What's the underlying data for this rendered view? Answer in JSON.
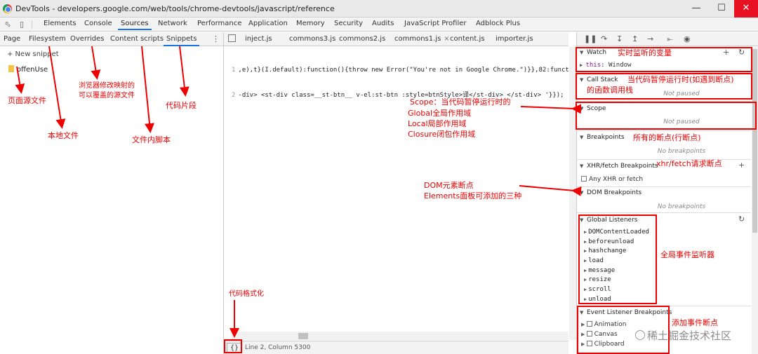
{
  "window": {
    "title": "DevTools - developers.google.com/web/tools/chrome-devtools/javascript/reference"
  },
  "main_tabs": [
    "Elements",
    "Console",
    "Sources",
    "Network",
    "Performance",
    "Application",
    "Memory",
    "Security",
    "Audits",
    "JavaScript Profiler",
    "Adblock Plus"
  ],
  "active_main_tab": "Sources",
  "navigator": {
    "tabs": [
      "Page",
      "Filesystem",
      "Overrides",
      "Content scripts",
      "Snippets"
    ],
    "active_tab": "Snippets",
    "new_snippet": "+ New snippet",
    "file": "offenUse"
  },
  "editor": {
    "tabs": [
      "inject.js",
      "commons3.js",
      "commons2.js",
      "commons1.js",
      "content.js",
      "importer.js"
    ],
    "active_tab": "commons1.js",
    "lines": [
      {
        "num": "1",
        "text": ",e),t}(I.default):function(){throw new Error(\"You're not in Google Chrome.\")}},82:funct"
      },
      {
        "num": "2",
        "text": "-div> <st-div class=__st-btn__ v-el:st-btn :style=btnStyle>译</st-div> </st-div> '}});"
      }
    ],
    "format_button": "{}",
    "status": "Line 2, Column 5300"
  },
  "debugger": {
    "watch": {
      "title": "Watch",
      "value_key": "this",
      "value": "Window"
    },
    "call_stack": {
      "title": "Call Stack",
      "empty": "Not paused"
    },
    "scope": {
      "title": "Scope",
      "empty": "Not paused"
    },
    "breakpoints": {
      "title": "Breakpoints",
      "empty": "No breakpoints"
    },
    "xhr": {
      "title": "XHR/fetch Breakpoints",
      "item": "Any XHR or fetch"
    },
    "dom": {
      "title": "DOM Breakpoints",
      "empty": "No breakpoints"
    },
    "global_listeners": {
      "title": "Global Listeners",
      "items": [
        "DOMContentLoaded",
        "beforeunload",
        "hashchange",
        "load",
        "message",
        "resize",
        "scroll",
        "unload"
      ]
    },
    "event_breakpoints": {
      "title": "Event Listener Breakpoints",
      "items": [
        "Animation",
        "Canvas",
        "Clipboard"
      ]
    }
  },
  "annotations": {
    "page_source": "页面源文件",
    "local_files": "本地文件",
    "overrides_line1": "浏览器修改映射的",
    "overrides_line2": "可以覆盖的源文件",
    "content_scripts": "文件内脚本",
    "snippets": "代码片段",
    "format": "代码格式化",
    "scope_line1": "Scope：当代码暂停运行时的",
    "scope_line2": "Global全局作用域",
    "scope_line3": "Local局部作用域",
    "scope_line4": "Closure闭包作用域",
    "dom_line1": "DOM元素断点",
    "dom_line2": "Elements面板可添加的三种",
    "watch": "实时监听的变量",
    "call_stack_line1": "当代码暂停运行时(如遇到断点)",
    "call_stack_line2": "的函数调用栈",
    "breakpoints": "所有的断点(行断点)",
    "xhr": "xhr/fetch请求断点",
    "global_listeners": "全局事件监听器",
    "event_breakpoints": "添加事件断点"
  },
  "watermark": "稀土掘金技术社区",
  "colors": {
    "annotation": "#e00000",
    "accent": "#1a73e8"
  }
}
